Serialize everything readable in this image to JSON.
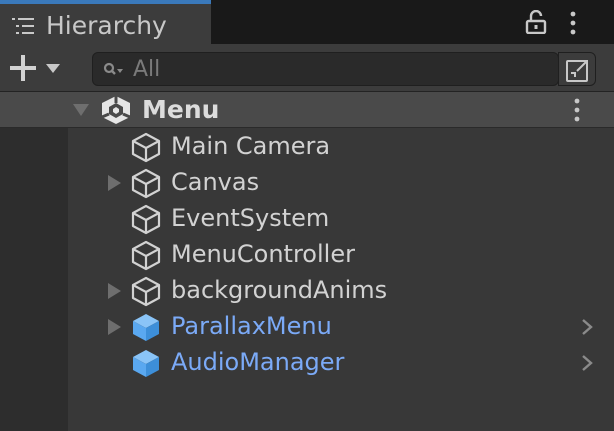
{
  "window": {
    "tab_title": "Hierarchy",
    "accent_color": "#3a79bb"
  },
  "toolbar": {
    "add_icon": "plus-dropdown-icon",
    "search_placeholder": "All",
    "search_value": "",
    "search_icon": "search-filter-icon",
    "filter_icon": "popout-icon"
  },
  "scene": {
    "name": "Menu",
    "icon": "unity-scene-icon",
    "expanded": true
  },
  "items": [
    {
      "name": "Main Camera",
      "has_children": false,
      "prefab": false
    },
    {
      "name": "Canvas",
      "has_children": true,
      "prefab": false
    },
    {
      "name": "EventSystem",
      "has_children": false,
      "prefab": false
    },
    {
      "name": "MenuController",
      "has_children": false,
      "prefab": false
    },
    {
      "name": "backgroundAnims",
      "has_children": true,
      "prefab": false
    },
    {
      "name": "ParallaxMenu",
      "has_children": true,
      "prefab": true
    },
    {
      "name": "AudioManager",
      "has_children": false,
      "prefab": true
    }
  ],
  "colors": {
    "prefab_text": "#7baaf7",
    "prefab_icon": "#5aa8f0",
    "gameobject_icon": "#d2d2d2"
  }
}
